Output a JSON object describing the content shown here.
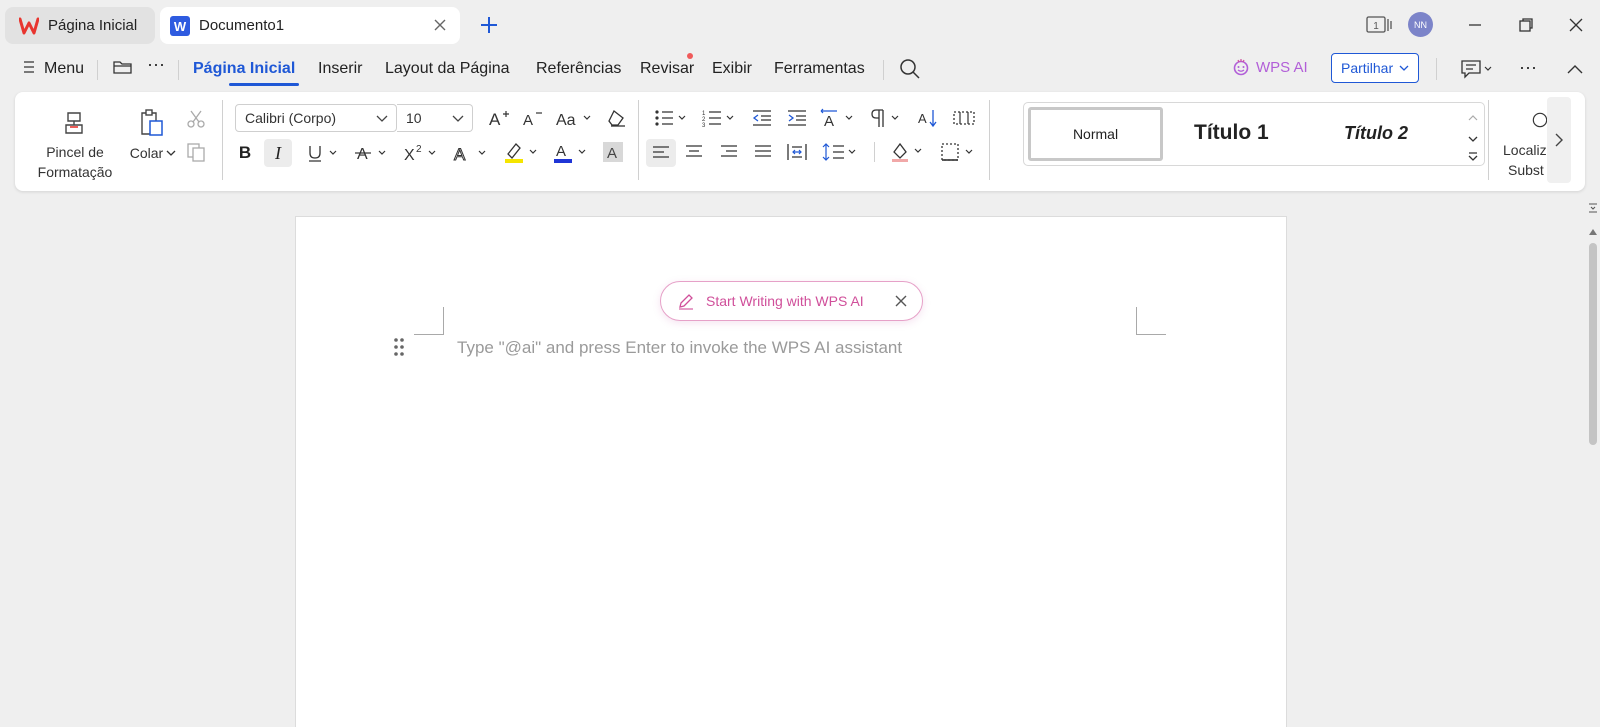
{
  "tabs": [
    {
      "label": "Página Inicial",
      "icon": "wps-logo-icon"
    },
    {
      "label": "Documento1",
      "icon": "word-doc-icon"
    }
  ],
  "titlebar": {
    "avatar_initials": "NN",
    "window_count": "1"
  },
  "menubar": {
    "menu_label": "Menu",
    "items": [
      "Página Inicial",
      "Inserir",
      "Layout da Página",
      "Referências",
      "Revisar",
      "Exibir",
      "Ferramentas"
    ],
    "active": "Página Inicial",
    "wps_ai_label": "WPS AI",
    "share_label": "Partilhar"
  },
  "ribbon": {
    "format_painter_label_1": "Pincel de",
    "format_painter_label_2": "Formatação",
    "paste_label": "Colar",
    "font_name": "Calibri (Corpo)",
    "font_size": "10",
    "styles": [
      "Normal",
      "Título 1",
      "Título 2"
    ],
    "find_label_1": "Localiz",
    "find_label_2": "Subst"
  },
  "document": {
    "ai_button_label": "Start Writing with WPS AI",
    "placeholder": "Type \"@ai\" and press Enter to invoke the WPS AI assistant"
  },
  "colors": {
    "accent": "#1f58d6",
    "wps_red": "#e8352f",
    "ai_pink": "#d04f9a",
    "highlight_yellow": "#f5e500",
    "font_color_blue": "#1f35d6"
  }
}
